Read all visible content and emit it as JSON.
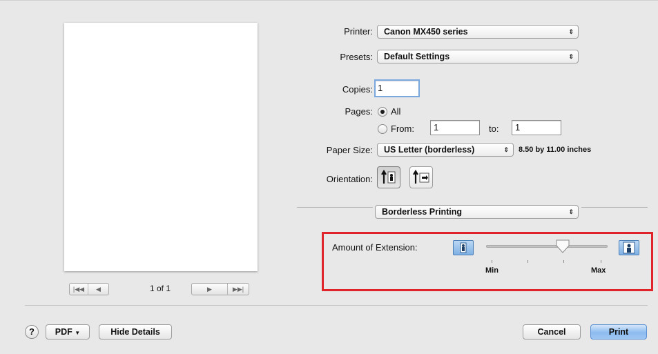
{
  "preview": {
    "page_count": "1 of 1"
  },
  "printer": {
    "label": "Printer:",
    "value": "Canon MX450 series"
  },
  "presets": {
    "label": "Presets:",
    "value": "Default Settings"
  },
  "copies": {
    "label": "Copies:",
    "value": "1"
  },
  "pages": {
    "label": "Pages:",
    "all_label": "All",
    "from_label": "From:",
    "from_value": "1",
    "to_label": "to:",
    "to_value": "1"
  },
  "paper_size": {
    "label": "Paper Size:",
    "value": "US Letter (borderless)",
    "dimensions": "8.50 by 11.00 inches"
  },
  "orientation": {
    "label": "Orientation:"
  },
  "panel_selector": {
    "value": "Borderless Printing"
  },
  "extension": {
    "label": "Amount of Extension:",
    "min_label": "Min",
    "max_label": "Max",
    "level": 0.65
  },
  "footer": {
    "help": "?",
    "pdf": "PDF",
    "hide_details": "Hide Details",
    "cancel": "Cancel",
    "print": "Print"
  },
  "colors": {
    "highlight_box": "#e0242b",
    "default_button": "#8cbbef"
  }
}
